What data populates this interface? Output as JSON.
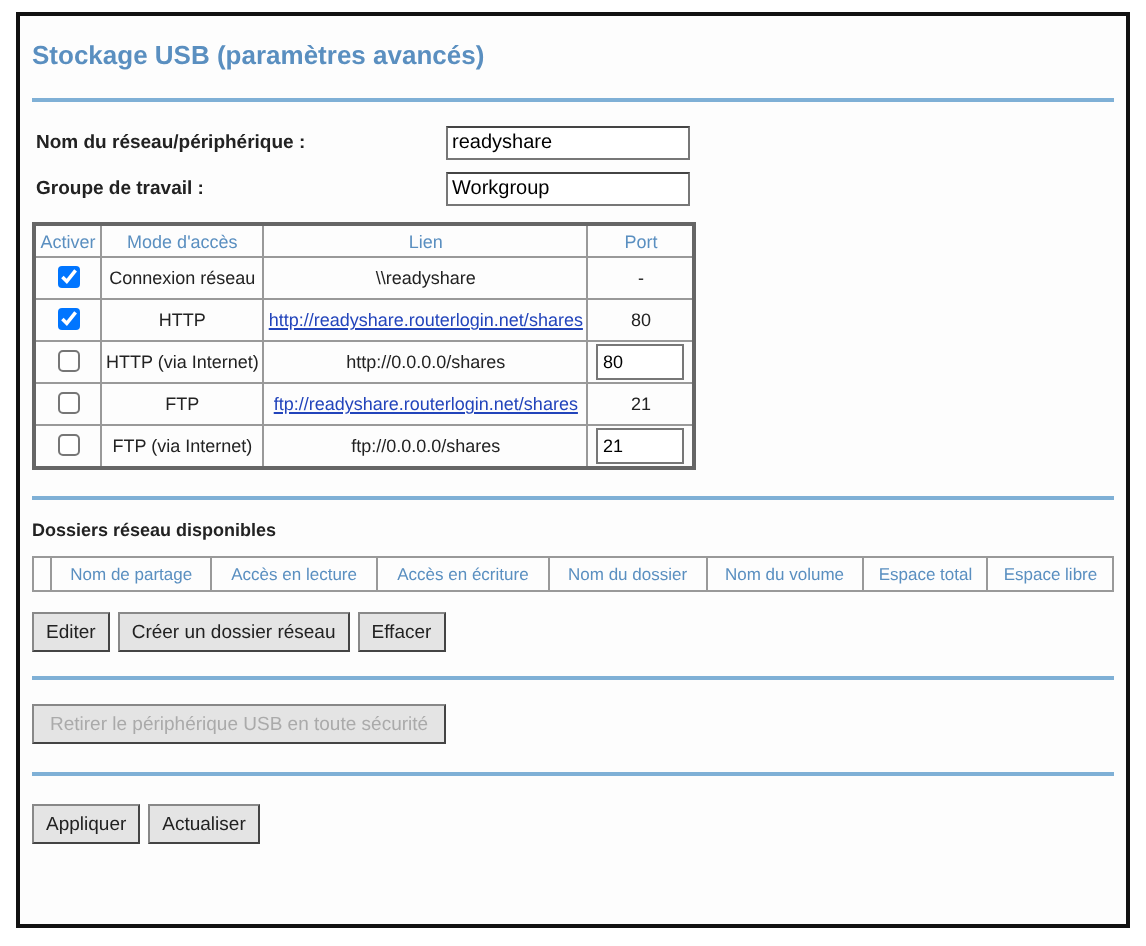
{
  "title": "Stockage USB (paramètres avancés)",
  "fields": [
    {
      "label": "Nom du réseau/périphérique :",
      "value": "readyshare"
    },
    {
      "label": "Groupe de travail :",
      "value": "Workgroup"
    }
  ],
  "access_table": {
    "columns": [
      "Activer",
      "Mode d'accès",
      "Lien",
      "Port"
    ],
    "rows": [
      {
        "checked": true,
        "mode": "Connexion réseau",
        "link": {
          "kind": "text",
          "text": "\\\\readyshare"
        },
        "port": {
          "kind": "text",
          "text": "-"
        }
      },
      {
        "checked": true,
        "mode": "HTTP",
        "link": {
          "kind": "link",
          "text": "http://readyshare.routerlogin.net/shares"
        },
        "port": {
          "kind": "text",
          "text": "80"
        }
      },
      {
        "checked": false,
        "mode": "HTTP (via Internet)",
        "link": {
          "kind": "text",
          "text": "http://0.0.0.0/shares"
        },
        "port": {
          "kind": "field",
          "text": "80"
        }
      },
      {
        "checked": false,
        "mode": "FTP",
        "link": {
          "kind": "link",
          "text": "ftp://readyshare.routerlogin.net/shares"
        },
        "port": {
          "kind": "text",
          "text": "21"
        }
      },
      {
        "checked": false,
        "mode": "FTP (via Internet)",
        "link": {
          "kind": "text",
          "text": "ftp://0.0.0.0/shares"
        },
        "port": {
          "kind": "field",
          "text": "21"
        }
      }
    ]
  },
  "folders": {
    "heading": "Dossiers réseau disponibles",
    "columns": [
      "Nom de partage",
      "Accès en lecture",
      "Accès en écriture",
      "Nom du dossier",
      "Nom du volume",
      "Espace total",
      "Espace libre"
    ],
    "buttons": [
      {
        "label": "Editer",
        "disabled": false
      },
      {
        "label": "Créer un dossier réseau",
        "disabled": false
      },
      {
        "label": "Effacer",
        "disabled": false
      }
    ]
  },
  "remove_button": {
    "label": "Retirer le périphérique USB en toute sécurité",
    "disabled": true
  },
  "footer_buttons": [
    {
      "label": "Appliquer",
      "disabled": false
    },
    {
      "label": "Actualiser",
      "disabled": false
    }
  ]
}
